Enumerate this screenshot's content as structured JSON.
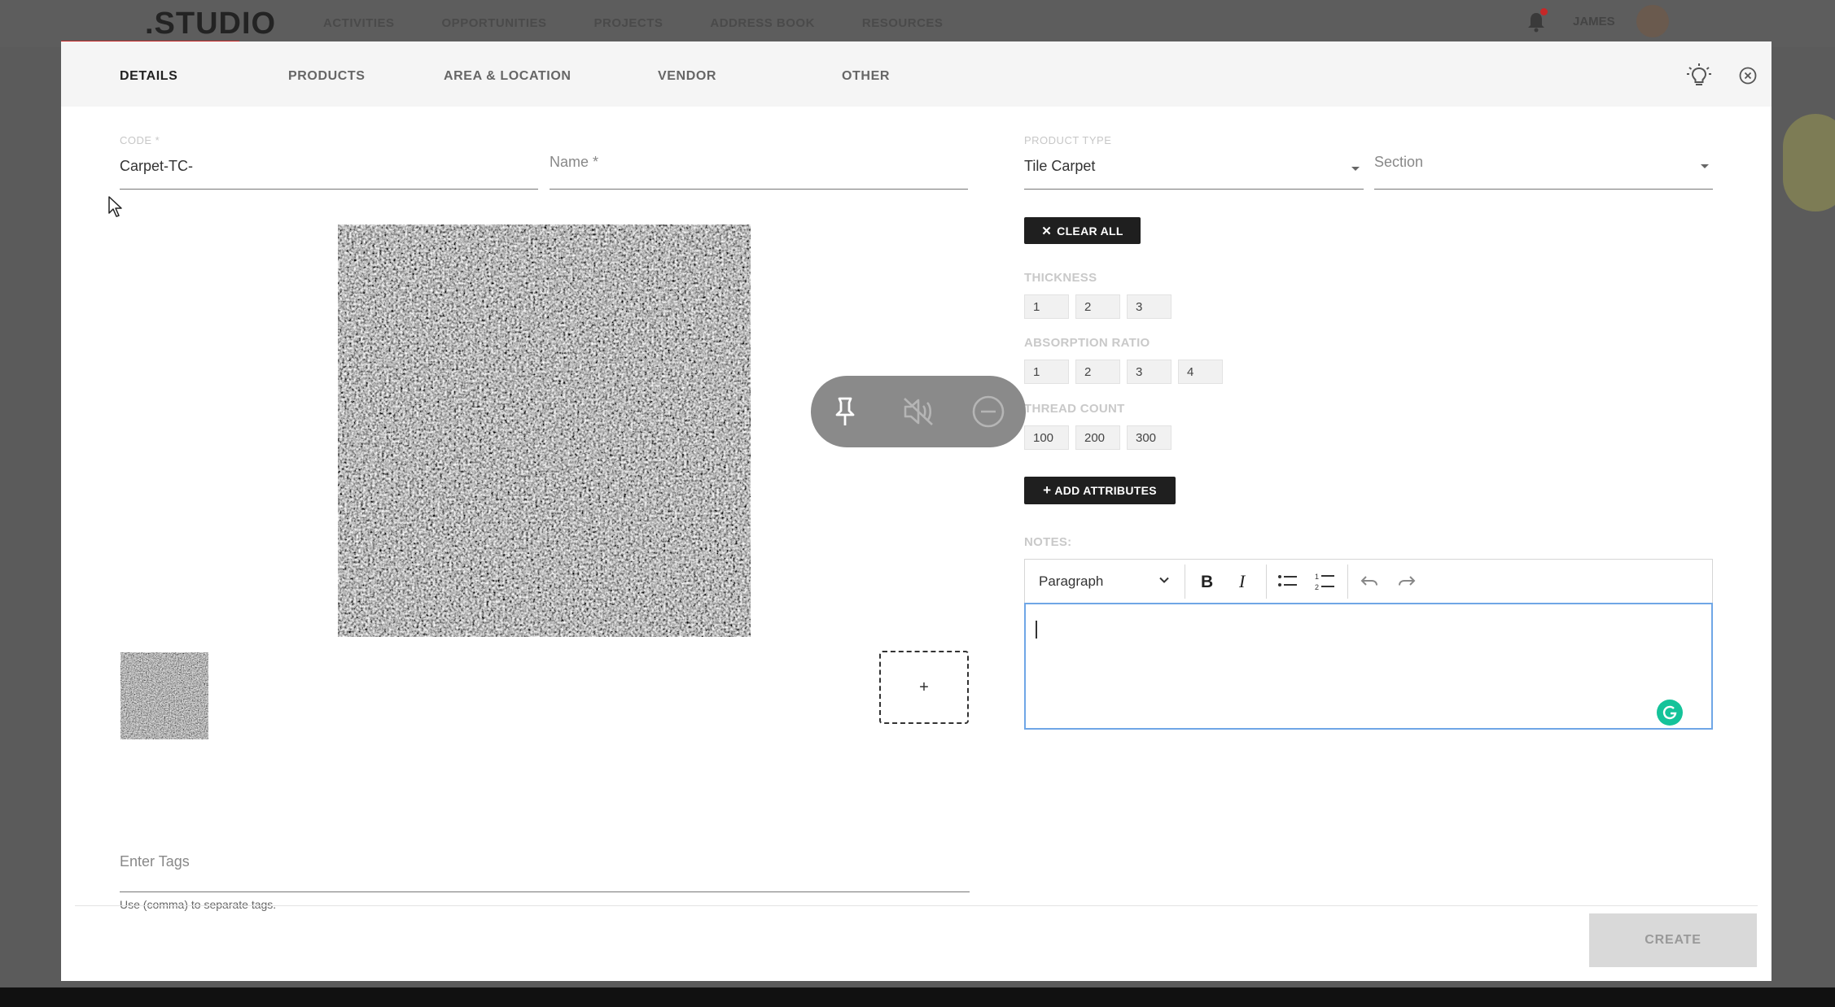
{
  "background_app": {
    "logo": ".STUDIO",
    "nav": [
      "ACTIVITIES",
      "OPPORTUNITIES",
      "PROJECTS",
      "ADDRESS BOOK",
      "RESOURCES"
    ],
    "user": "JAMES"
  },
  "modal": {
    "tabs": [
      "DETAILS",
      "PRODUCTS",
      "AREA & LOCATION",
      "VENDOR",
      "OTHER"
    ],
    "active_tab": "DETAILS",
    "code": {
      "label": "CODE *",
      "value": "Carpet-TC-"
    },
    "name": {
      "placeholder": "Name *"
    },
    "product_type": {
      "label": "PRODUCT TYPE",
      "value": "Tile Carpet"
    },
    "section": {
      "placeholder": "Section"
    },
    "clear_all_label": "CLEAR ALL",
    "attributes": [
      {
        "label": "THICKNESS",
        "options": [
          "1",
          "2",
          "3"
        ]
      },
      {
        "label": "ABSORPTION RATIO",
        "options": [
          "1",
          "2",
          "3",
          "4"
        ]
      },
      {
        "label": "THREAD COUNT",
        "options": [
          "100",
          "200",
          "300"
        ]
      }
    ],
    "add_attributes_label": "ADD ATTRIBUTES",
    "notes": {
      "label": "NOTES:",
      "format": "Paragraph",
      "content": ""
    },
    "add_image_label": "+",
    "tags": {
      "placeholder": "Enter Tags",
      "help": "Use (comma) to separate tags."
    },
    "create_label": "CREATE"
  },
  "colors": {
    "accent": "#c62828",
    "dark_button": "#1f1f1f",
    "editor_focus": "#6fa6e6",
    "grammarly": "#15c39a",
    "create_disabled_bg": "#d9d9d9"
  },
  "icons": {
    "header": [
      "lightbulb-icon",
      "close-circle-icon"
    ],
    "floating_pill": [
      "pin-icon",
      "mute-icon",
      "minus-circle-icon"
    ],
    "toolbar": [
      "chevron-down-icon",
      "bold-icon",
      "italic-icon",
      "bullet-list-icon",
      "numbered-list-icon",
      "undo-icon",
      "redo-icon"
    ]
  }
}
